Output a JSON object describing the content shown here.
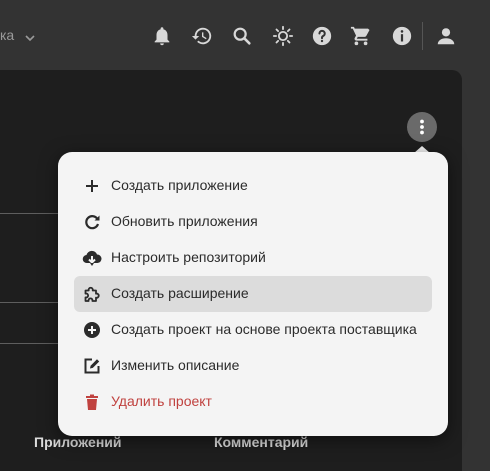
{
  "topbar": {
    "breadcrumb_tail": "ка",
    "icons": [
      "bell-icon",
      "history-icon",
      "search-icon",
      "brightness-icon",
      "help-icon",
      "cart-icon",
      "info-icon",
      "account-icon"
    ]
  },
  "table": {
    "col_applications": "Приложений",
    "col_comments": "Комментарий"
  },
  "menu": {
    "items": [
      {
        "label": "Создать приложение",
        "icon": "plus-icon"
      },
      {
        "label": "Обновить приложения",
        "icon": "refresh-icon"
      },
      {
        "label": "Настроить репозиторий",
        "icon": "cloud-download-icon"
      },
      {
        "label": "Создать расширение",
        "icon": "puzzle-icon"
      },
      {
        "label": "Создать проект на основе проекта поставщика",
        "icon": "add-circle-icon"
      },
      {
        "label": "Изменить описание",
        "icon": "edit-icon"
      },
      {
        "label": "Удалить проект",
        "icon": "trash-icon"
      }
    ],
    "highlighted_index": 3
  },
  "colors": {
    "background": "#333333",
    "panel": "#1e1e1e",
    "menu_bg": "#f4f4f4",
    "highlight": "#dcdcdc",
    "danger": "#c0423f",
    "icon": "#d8d8d8"
  }
}
